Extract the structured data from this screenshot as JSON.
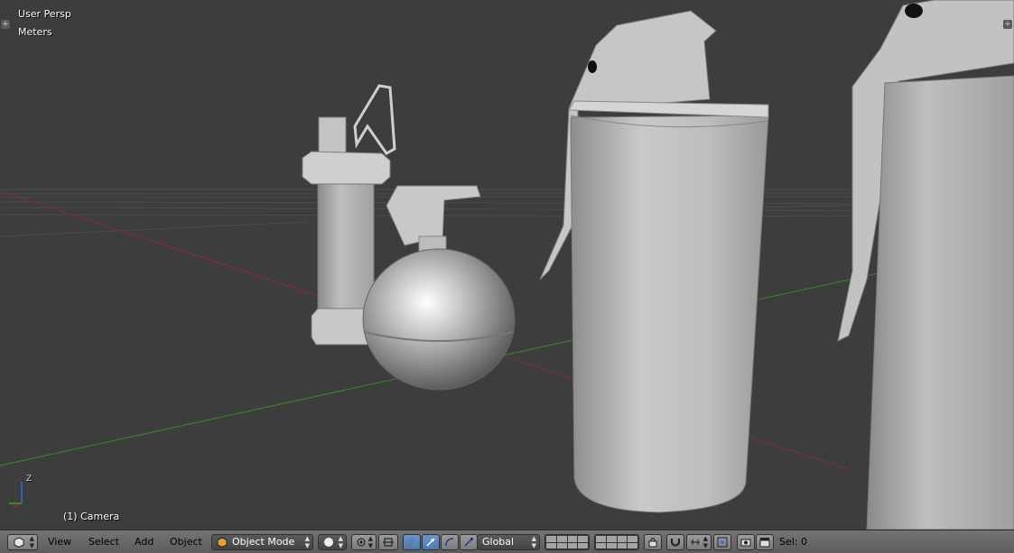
{
  "viewport": {
    "view_name": "User Persp",
    "units": "Meters",
    "active_object": "(1) Camera",
    "axis_label": "Z"
  },
  "header": {
    "menus": [
      "View",
      "Select",
      "Add",
      "Object"
    ],
    "mode": "Object Mode",
    "transform_orientation": "Global",
    "selection": "Sel: 0"
  },
  "icons": {
    "editor_type": "3d-view-cube-icon",
    "viewport_shading": "solid-sphere-icon",
    "pivot": "pivot-point-icon",
    "manipulator": "manipulator-widget-icon",
    "snap": "magnet-icon",
    "render": "camera-icon"
  },
  "colors": {
    "viewport_bg": "#3d3d3d",
    "header_bg": "#6b6b6b",
    "x_axis": "#8a2d2d",
    "y_axis": "#3a8a2a",
    "z_axis": "#2d5fbf",
    "active_blue": "#5681bd"
  }
}
